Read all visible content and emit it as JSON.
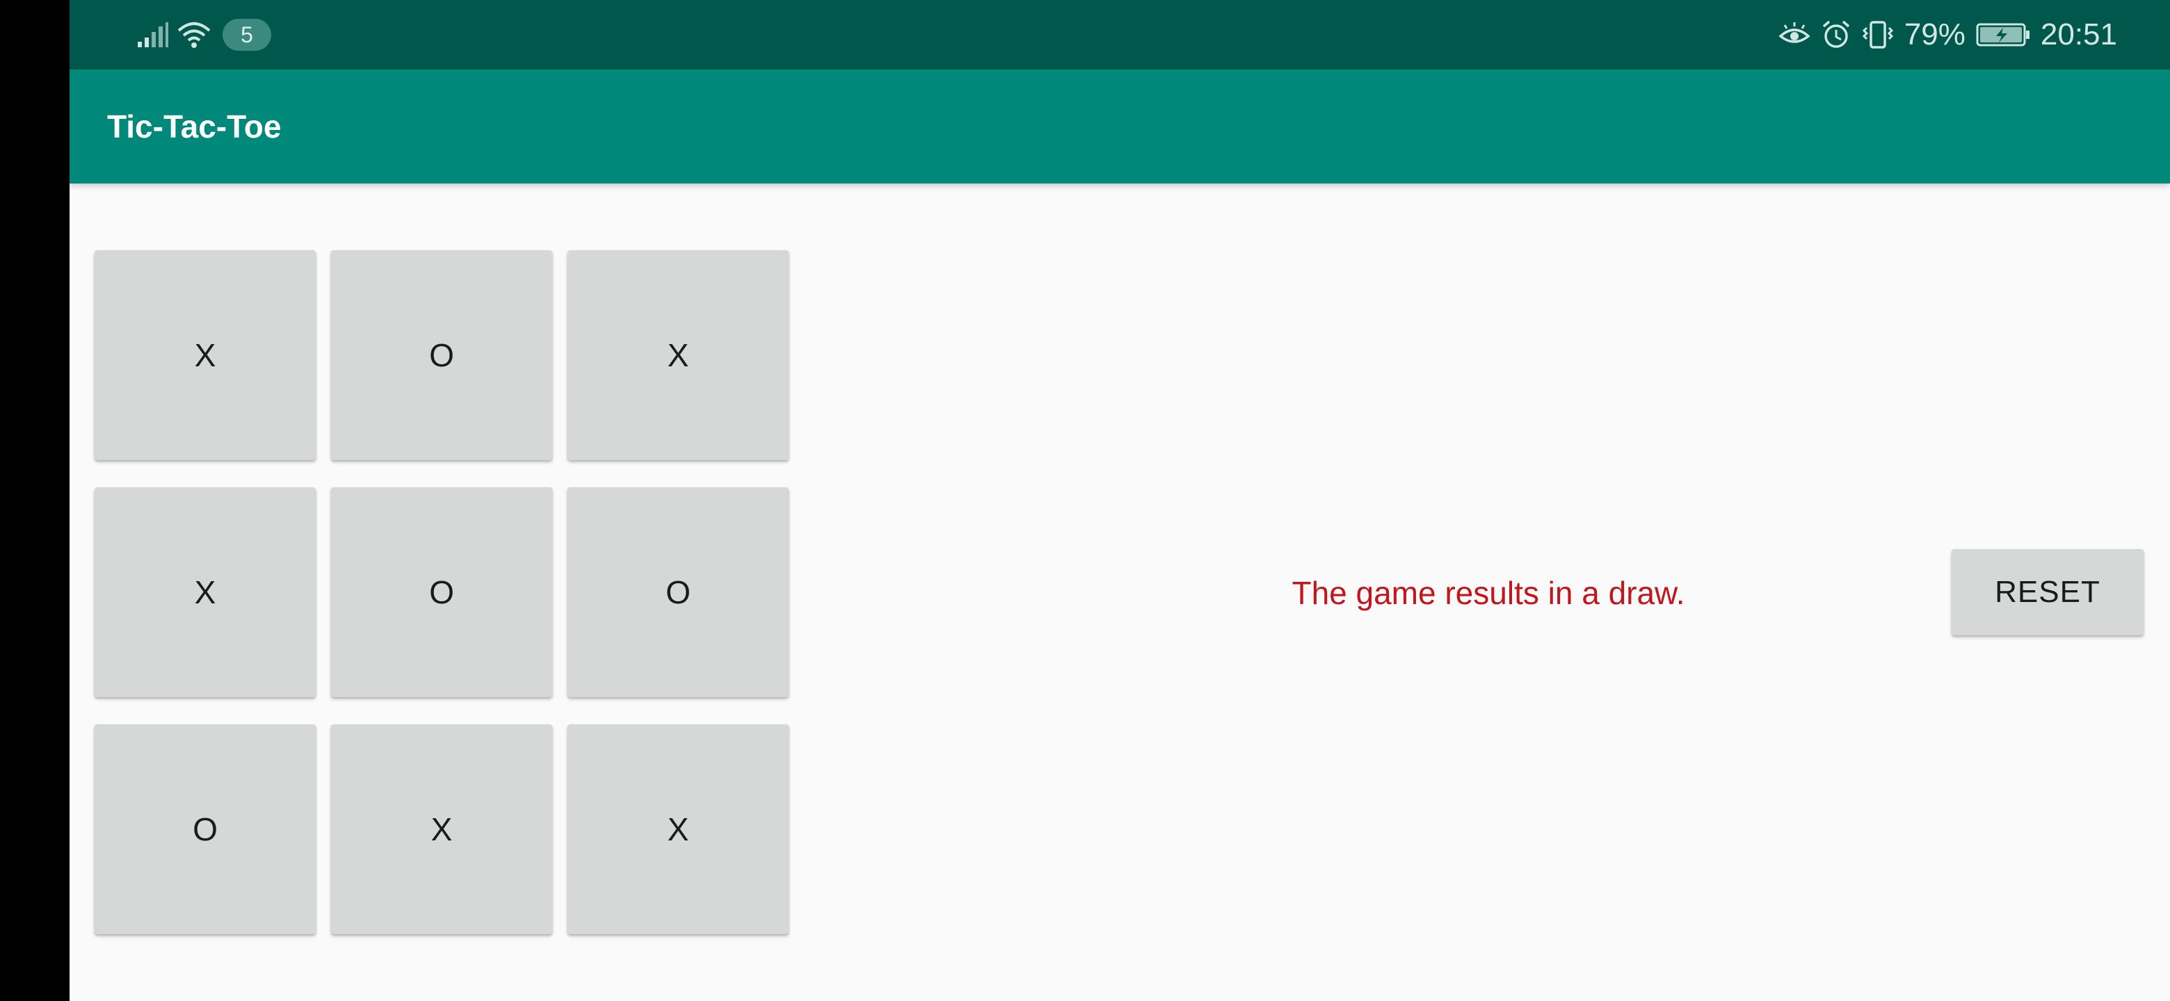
{
  "status_bar": {
    "notification_count": "5",
    "battery_percent": "79%",
    "time": "20:51",
    "left_icons": [
      "signal-icon",
      "wifi-icon"
    ],
    "right_icons": [
      "eye-comfort-icon",
      "alarm-icon",
      "vibrate-icon",
      "battery-charging-icon"
    ]
  },
  "app_bar": {
    "title": "Tic-Tac-Toe"
  },
  "board": {
    "cells": [
      "X",
      "O",
      "X",
      "X",
      "O",
      "O",
      "O",
      "X",
      "X"
    ]
  },
  "game": {
    "result": "The game results in a draw.",
    "reset_label": "RESET"
  },
  "colors": {
    "status_bar": "#00574b",
    "app_bar": "#00897b",
    "background": "#fafafa",
    "cell": "#d6d7d7",
    "result_text": "#c0161c"
  }
}
